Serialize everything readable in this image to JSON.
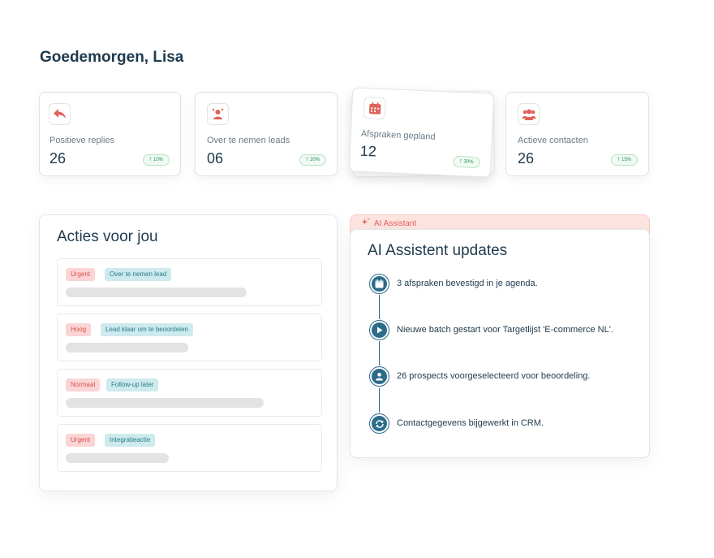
{
  "greeting": "Goedemorgen, Lisa",
  "stats": [
    {
      "icon": "reply-icon",
      "label": "Positieve replies",
      "value": "26",
      "change": "10%"
    },
    {
      "icon": "leads-icon",
      "label": "Over te nemen leads",
      "value": "06",
      "change": "20%"
    },
    {
      "icon": "calendar-icon",
      "label": "Afspraken gepland",
      "value": "12",
      "change": "30%"
    },
    {
      "icon": "contacts-icon",
      "label": "Actieve contacten",
      "value": "26",
      "change": "15%"
    }
  ],
  "actions_panel": {
    "title": "Acties voor jou",
    "items": [
      {
        "priority": "Urgent",
        "type": "Over te nemen lead"
      },
      {
        "priority": "Hoog",
        "type": "Lead klaar om te beoordelen"
      },
      {
        "priority": "Normaal",
        "type": "Follow-up later"
      },
      {
        "priority": "Urgent",
        "type": "Integratieactie"
      }
    ]
  },
  "ai_panel": {
    "badge": "AI Assistant",
    "title": "AI Assistent updates",
    "updates": [
      {
        "icon": "calendar-icon",
        "text": "3 afspraken bevestigd in je agenda."
      },
      {
        "icon": "play-icon",
        "text": "Nieuwe batch gestart voor Targetlijst 'E-commerce NL'."
      },
      {
        "icon": "person-icon",
        "text": "26 prospects voorgeselecteerd voor beoordeling."
      },
      {
        "icon": "refresh-icon",
        "text": "Contactgegevens bijgewerkt in CRM."
      }
    ]
  },
  "colors": {
    "accent": "#e0625a",
    "navy": "#1f3a4d",
    "timeline": "#2c6b8a",
    "positive": "#2e8b57"
  }
}
